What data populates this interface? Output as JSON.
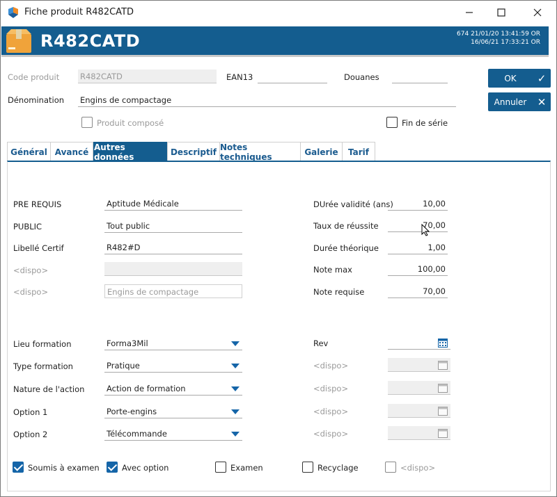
{
  "window": {
    "title": "Fiche produit R482CATD"
  },
  "banner": {
    "code": "R482CATD",
    "info_line1": "674  21/01/20 13:41:59  OR",
    "info_line2": "16/06/21 17:33:21  OR"
  },
  "header": {
    "code_label": "Code produit",
    "code_value": "R482CATD",
    "ean_label": "EAN13",
    "ean_value": "",
    "douanes_label": "Douanes",
    "douanes_value": "",
    "denom_label": "Dénomination",
    "denom_value": "Engins de compactage",
    "compose_label": "Produit composé",
    "finserie_label": "Fin de série"
  },
  "buttons": {
    "ok": "OK",
    "cancel": "Annuler"
  },
  "tabs": [
    "Général",
    "Avancé",
    "Autres données",
    "Descriptif",
    "Notes techniques",
    "Galerie",
    "Tarif"
  ],
  "left_fields": [
    {
      "label": "PRE REQUIS",
      "value": "Aptitude Médicale"
    },
    {
      "label": "PUBLIC",
      "value": "Tout public"
    },
    {
      "label": "Libellé Certif",
      "value": "R482#D"
    },
    {
      "label": "<dispo>",
      "value": ""
    },
    {
      "label": "<dispo>",
      "value": "Engins de compactage"
    }
  ],
  "right_fields": [
    {
      "label": "DUrée validité (ans)",
      "value": "10,00"
    },
    {
      "label": "Taux de réussite",
      "value": "70,00"
    },
    {
      "label": "Durée théorique",
      "value": "1,00"
    },
    {
      "label": "Note max",
      "value": "100,00"
    },
    {
      "label": "Note requise",
      "value": "70,00"
    }
  ],
  "combos": [
    {
      "label": "Lieu formation",
      "value": "Forma3Mil"
    },
    {
      "label": "Type formation",
      "value": "Pratique"
    },
    {
      "label": "Nature de l'action",
      "value": "Action de formation"
    },
    {
      "label": "Option 1",
      "value": "Porte-engins"
    },
    {
      "label": "Option 2",
      "value": "Télécommande"
    }
  ],
  "dates": [
    {
      "label": "Rev",
      "value": ""
    },
    {
      "label": "<dispo>",
      "value": ""
    },
    {
      "label": "<dispo>",
      "value": ""
    },
    {
      "label": "<dispo>",
      "value": ""
    },
    {
      "label": "<dispo>",
      "value": ""
    }
  ],
  "checkboxes": [
    {
      "label": "Soumis à examen",
      "checked": true
    },
    {
      "label": "Avec option",
      "checked": true
    },
    {
      "label": "Examen",
      "checked": false
    },
    {
      "label": "Recyclage",
      "checked": false
    },
    {
      "label": "<dispo>",
      "checked": false
    }
  ],
  "colors": {
    "accent": "#145d8f",
    "check": "#1565a8"
  }
}
